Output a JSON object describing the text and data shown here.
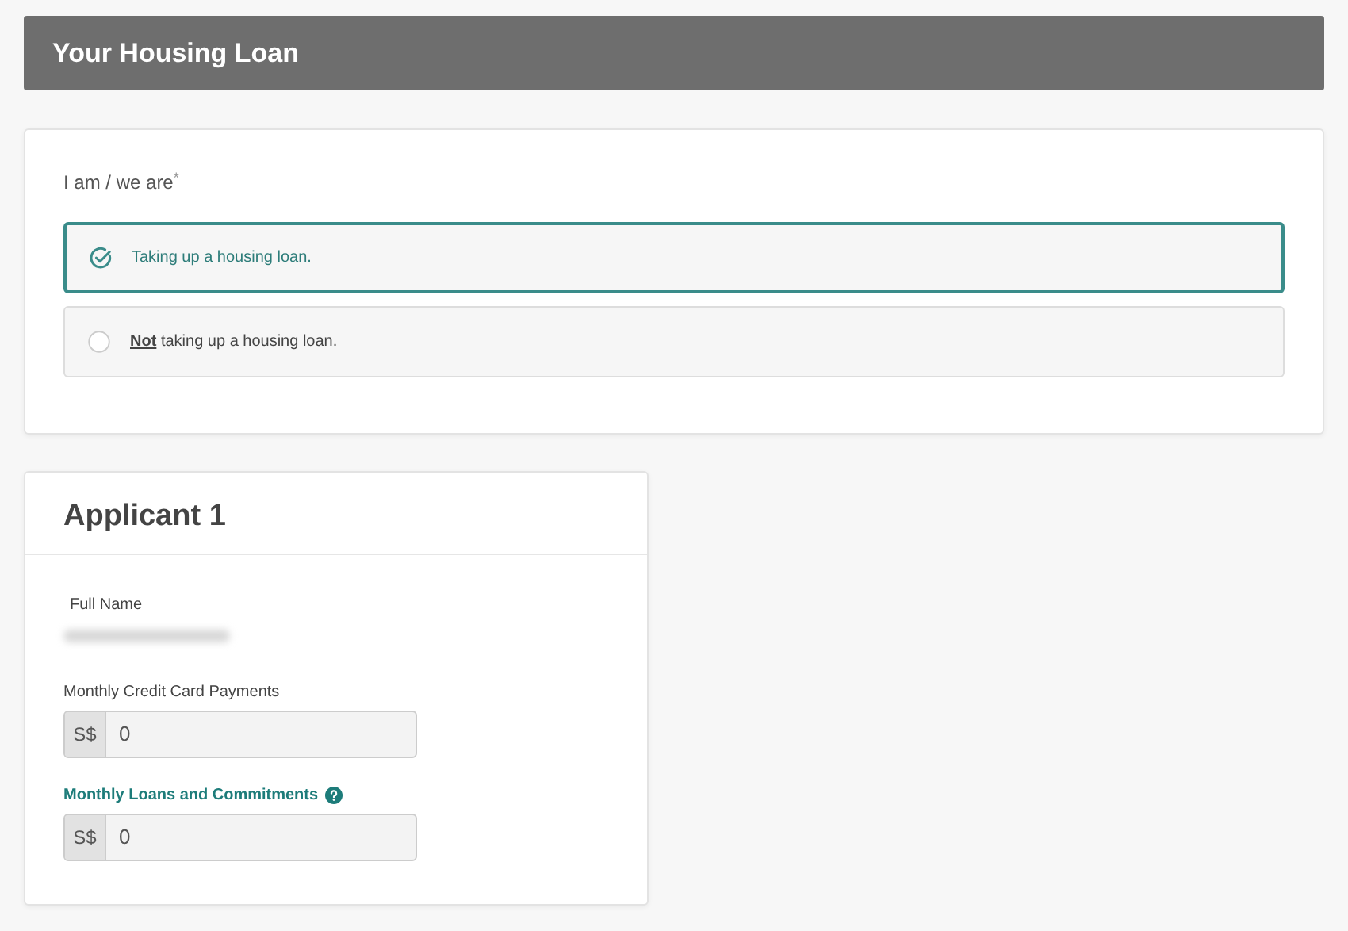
{
  "header": {
    "title": "Your Housing Loan"
  },
  "question": {
    "label": "I am / we are",
    "required_mark": "*"
  },
  "options": [
    {
      "label": "Taking up a housing loan.",
      "selected": true
    },
    {
      "label": "**Not** taking up a housing loan.",
      "selected": false
    }
  ],
  "applicant": {
    "title": "Applicant 1",
    "full_name_label": "Full Name",
    "fields": [
      {
        "label": "Monthly Credit Card Payments",
        "highlighted": false,
        "help": false,
        "prefix": "S$",
        "value": "0"
      },
      {
        "label": "Monthly Loans and Commitments",
        "highlighted": true,
        "help": true,
        "prefix": "S$",
        "value": "0"
      }
    ]
  }
}
